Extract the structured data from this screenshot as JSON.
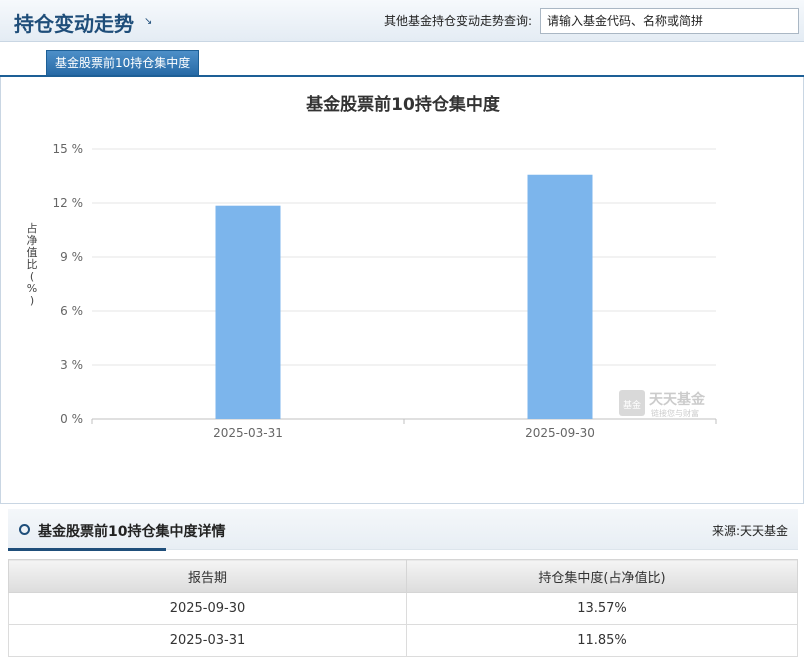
{
  "header": {
    "title": "持仓变动走势",
    "title_arrow": "↘",
    "search_label": "其他基金持仓变动走势查询:",
    "search_placeholder": "请输入基金代码、名称或简拼"
  },
  "tabs": [
    {
      "label": "基金股票前10持仓集中度"
    }
  ],
  "chart_data": {
    "type": "bar",
    "title": "基金股票前10持仓集中度",
    "xlabel": "",
    "ylabel": "占净值比(%)",
    "ylabel_chars": [
      "占",
      "净",
      "值",
      "比",
      "(",
      "%",
      ")"
    ],
    "categories": [
      "2025-03-31",
      "2025-09-30"
    ],
    "values": [
      11.85,
      13.57
    ],
    "ylim": [
      0,
      15
    ],
    "yticks": [
      0,
      3,
      6,
      9,
      12,
      15
    ],
    "ytick_labels": [
      "0 %",
      "3 %",
      "6 %",
      "9 %",
      "12 %",
      "15 %"
    ],
    "grid": true,
    "bar_color": "#7cb5ec",
    "watermark": {
      "main": "天天基金",
      "sub": "链接您与财富",
      "logo": "基金"
    }
  },
  "details": {
    "title": "基金股票前10持仓集中度详情",
    "source": "来源:天天基金",
    "columns": [
      "报告期",
      "持仓集中度(占净值比)"
    ],
    "rows": [
      {
        "date": "2025-09-30",
        "value": "13.57%"
      },
      {
        "date": "2025-03-31",
        "value": "11.85%"
      }
    ]
  }
}
